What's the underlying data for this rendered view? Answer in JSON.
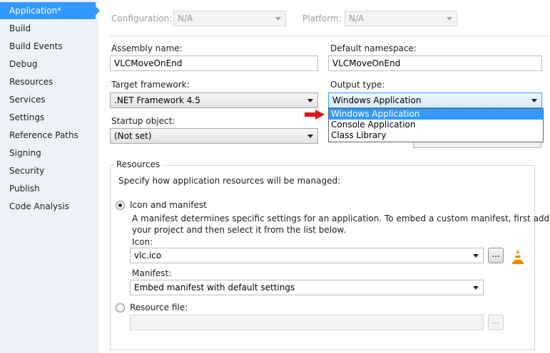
{
  "sidebar": {
    "items": [
      {
        "label": "Application*",
        "active": true
      },
      {
        "label": "Build"
      },
      {
        "label": "Build Events"
      },
      {
        "label": "Debug"
      },
      {
        "label": "Resources"
      },
      {
        "label": "Services"
      },
      {
        "label": "Settings"
      },
      {
        "label": "Reference Paths"
      },
      {
        "label": "Signing"
      },
      {
        "label": "Security"
      },
      {
        "label": "Publish"
      },
      {
        "label": "Code Analysis"
      }
    ],
    "accent_color": "#3399ff"
  },
  "top": {
    "configuration_label": "Configuration:",
    "configuration_value": "N/A",
    "platform_label": "Platform:",
    "platform_value": "N/A"
  },
  "form": {
    "assembly_name_label": "Assembly name:",
    "assembly_name_value": "VLCMoveOnEnd",
    "default_namespace_label": "Default namespace:",
    "default_namespace_value": "VLCMoveOnEnd",
    "target_framework_label": "Target framework:",
    "target_framework_value": ".NET Framework 4.5",
    "output_type_label": "Output type:",
    "output_type_value": "Windows Application",
    "output_type_options": [
      "Windows Application",
      "Console Application",
      "Class Library"
    ],
    "startup_object_label": "Startup object:",
    "startup_object_value": "(Not set)"
  },
  "resources": {
    "group_title": "Resources",
    "description": "Specify how application resources will be managed:",
    "icon_manifest_label": "Icon and manifest",
    "icon_manifest_desc_line1": "A manifest determines specific settings for an application. To embed a custom manifest, first add it to",
    "icon_manifest_desc_line2": "your project and then select it from the list below.",
    "icon_label": "Icon:",
    "icon_value": "vlc.ico",
    "browse_label": "...",
    "manifest_label": "Manifest:",
    "manifest_value": "Embed manifest with default settings",
    "resource_file_label": "Resource file:",
    "resource_file_value": "",
    "browse2_label": "..."
  }
}
